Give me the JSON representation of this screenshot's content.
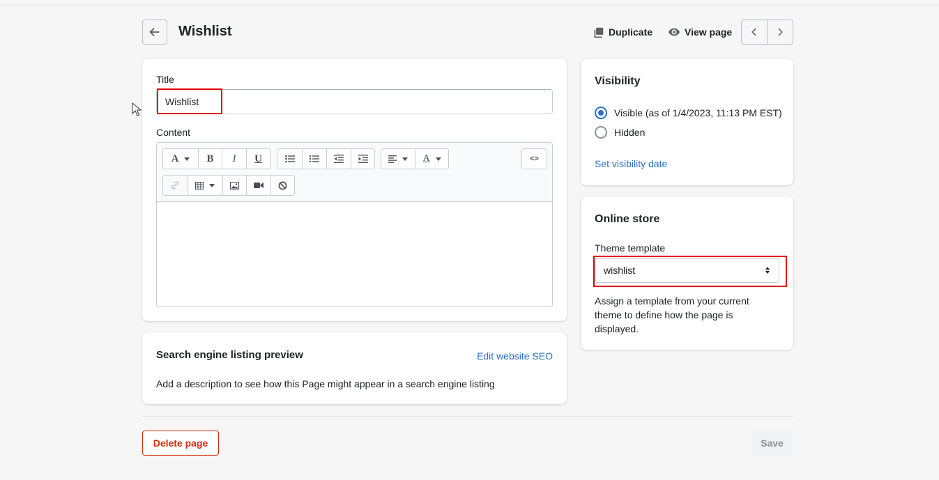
{
  "header": {
    "title": "Wishlist",
    "duplicate_label": "Duplicate",
    "view_page_label": "View page"
  },
  "main": {
    "title_label": "Title",
    "title_value": "Wishlist",
    "content_label": "Content",
    "toolbar": {
      "font_glyph": "A",
      "bold_glyph": "B",
      "italic_glyph": "I",
      "underline_glyph": "U",
      "text_color_glyph": "A",
      "html_glyph": "<>"
    }
  },
  "seo": {
    "title": "Search engine listing preview",
    "edit_link": "Edit website SEO",
    "description": "Add a description to see how this Page might appear in a search engine listing"
  },
  "visibility": {
    "title": "Visibility",
    "options": [
      {
        "label": "Visible (as of 1/4/2023, 11:13 PM EST)",
        "selected": true
      },
      {
        "label": "Hidden",
        "selected": false
      }
    ],
    "set_date_link": "Set visibility date"
  },
  "online_store": {
    "title": "Online store",
    "template_label": "Theme template",
    "template_value": "wishlist",
    "help_text": "Assign a template from your current theme to define how the page is displayed."
  },
  "footer": {
    "delete_label": "Delete page",
    "save_label": "Save"
  },
  "colors": {
    "accent": "#2c6ecb",
    "danger": "#d72c0d",
    "highlight": "#e20000"
  }
}
